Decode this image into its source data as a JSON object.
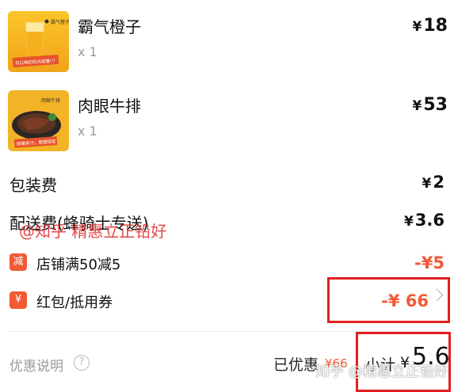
{
  "items": [
    {
      "name": "霸气橙子",
      "qty": "x 1",
      "currency": "¥",
      "price": "18",
      "thumb_brand": "霸气橙子",
      "thumb_tag": "可以喝的阳光能量!!!"
    },
    {
      "name": "肉眼牛排",
      "qty": "x 1",
      "currency": "¥",
      "price": "53",
      "thumb_brand": "肉眼牛排",
      "thumb_tag": "鲜嫩多汁，肥瘦相宜"
    }
  ],
  "fees": {
    "packaging_label": "包装费",
    "packaging_currency": "¥",
    "packaging_value": "2",
    "delivery_label": "配送费(蜂骑士专送)",
    "delivery_currency": "¥",
    "delivery_value": "3.6"
  },
  "discounts": {
    "store_badge": "减",
    "store_label": "店铺满50减5",
    "store_value": "-¥5",
    "coupon_badge": "¥",
    "coupon_label": "红包/抵用券",
    "coupon_value": "-¥ 66"
  },
  "footer": {
    "notes_label": "优惠说明",
    "help_icon": "?",
    "saved_label": "已优惠",
    "saved_value": "¥66",
    "subtotal_label": "小计",
    "subtotal_currency": "¥",
    "subtotal_value": "5.6"
  },
  "watermarks": {
    "mid_overlay": "@知乎 精惠立正铅好",
    "bottom_overlay": "知乎 @精惠立正铅好"
  },
  "colors": {
    "accent_red": "#f15a35",
    "annotation_box": "#e02020"
  }
}
